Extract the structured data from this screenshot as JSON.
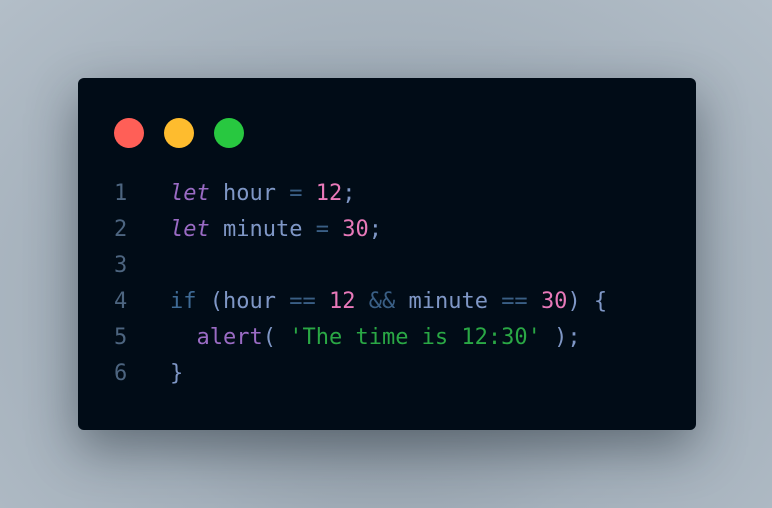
{
  "window_controls": {
    "close_color": "#ff5f57",
    "minimize_color": "#febc2e",
    "maximize_color": "#28c840"
  },
  "code": {
    "line_numbers": [
      "1",
      "2",
      "3",
      "4",
      "5",
      "6"
    ],
    "lines": [
      [
        {
          "text": "let",
          "kind": "kw-let"
        },
        {
          "text": " hour ",
          "kind": "id"
        },
        {
          "text": "=",
          "kind": "op"
        },
        {
          "text": " ",
          "kind": "id"
        },
        {
          "text": "12",
          "kind": "num"
        },
        {
          "text": ";",
          "kind": "id"
        }
      ],
      [
        {
          "text": "let",
          "kind": "kw-let"
        },
        {
          "text": " minute ",
          "kind": "id"
        },
        {
          "text": "=",
          "kind": "op"
        },
        {
          "text": " ",
          "kind": "id"
        },
        {
          "text": "30",
          "kind": "num"
        },
        {
          "text": ";",
          "kind": "id"
        }
      ],
      [],
      [
        {
          "text": "if",
          "kind": "kw-if"
        },
        {
          "text": " (hour ",
          "kind": "id"
        },
        {
          "text": "==",
          "kind": "op"
        },
        {
          "text": " ",
          "kind": "id"
        },
        {
          "text": "12",
          "kind": "num"
        },
        {
          "text": " ",
          "kind": "id"
        },
        {
          "text": "&&",
          "kind": "op"
        },
        {
          "text": " minute ",
          "kind": "id"
        },
        {
          "text": "==",
          "kind": "op"
        },
        {
          "text": " ",
          "kind": "id"
        },
        {
          "text": "30",
          "kind": "num"
        },
        {
          "text": ") {",
          "kind": "id"
        }
      ],
      [
        {
          "text": "  ",
          "kind": "id"
        },
        {
          "text": "alert",
          "kind": "fn"
        },
        {
          "text": "( ",
          "kind": "id"
        },
        {
          "text": "'The time is 12:30'",
          "kind": "str"
        },
        {
          "text": " );",
          "kind": "id"
        }
      ],
      [
        {
          "text": "}",
          "kind": "id"
        }
      ]
    ]
  }
}
